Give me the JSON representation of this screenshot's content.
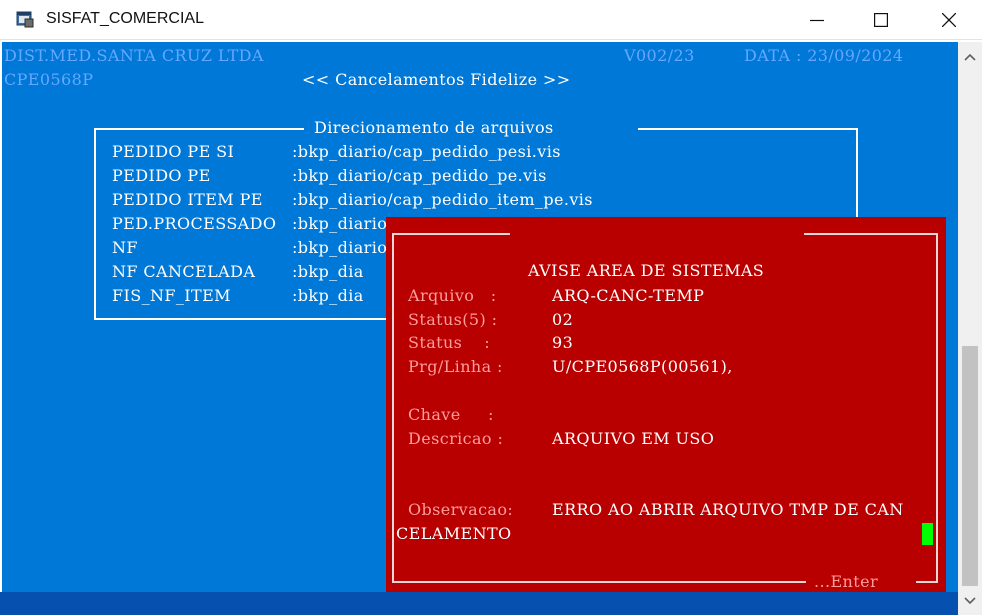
{
  "window": {
    "title": "SISFAT_COMERCIAL",
    "icon": "app-window-icon",
    "controls": [
      "minimize-icon",
      "maximize-icon",
      "close-icon"
    ]
  },
  "terminal": {
    "company": "DIST.MED.SANTA CRUZ LTDA",
    "version": "V002/23",
    "date_label": "DATA : 23/09/2024",
    "program_code": "CPE0568P",
    "screen_title": "<< Cancelamentos Fidelize >>",
    "colors": {
      "background": "#0078d7",
      "header_text": "#64a8ff",
      "text": "#ffffff"
    }
  },
  "files_box": {
    "title": "Direcionamento de arquivos",
    "rows": [
      {
        "label": "PEDIDO PE SI",
        "path": ":bkp_diario/cap_pedido_pesi.vis"
      },
      {
        "label": "PEDIDO PE",
        "path": ":bkp_diario/cap_pedido_pe.vis"
      },
      {
        "label": "PEDIDO ITEM PE",
        "path": ":bkp_diario/cap_pedido_item_pe.vis"
      },
      {
        "label": "PED.PROCESSADO",
        "path": ":bkp_diario/cap_pedido_processado.vis"
      },
      {
        "label": "NF",
        "path": ":bkp_diario/fis_nf.vis"
      },
      {
        "label": "NF CANCELADA",
        "path": ":bkp_dia"
      },
      {
        "label": "FIS_NF_ITEM",
        "path": ":bkp_dia"
      }
    ]
  },
  "alert": {
    "title": "AVISE AREA DE SISTEMAS",
    "fields": [
      {
        "label": "Arquivo   :",
        "value": "ARQ-CANC-TEMP"
      },
      {
        "label": "Status(5) :",
        "value": "02"
      },
      {
        "label": "Status    :",
        "value": "93"
      },
      {
        "label": "Prg/Linha :",
        "value": "U/CPE0568P(00561),"
      },
      {
        "label": "Chave     :",
        "value": ""
      },
      {
        "label": "Descricao :",
        "value": "ARQUIVO EM USO"
      }
    ],
    "observation_label": "Observacao:",
    "observation_value": "ERRO AO ABRIR ARQUIVO TMP DE CAN",
    "observation_continuation": "CELAMENTO",
    "footer": "...Enter",
    "colors": {
      "background": "#b80000",
      "label": "#ff9c9c",
      "value": "#ffffff",
      "cursor": "#00ff00"
    }
  }
}
